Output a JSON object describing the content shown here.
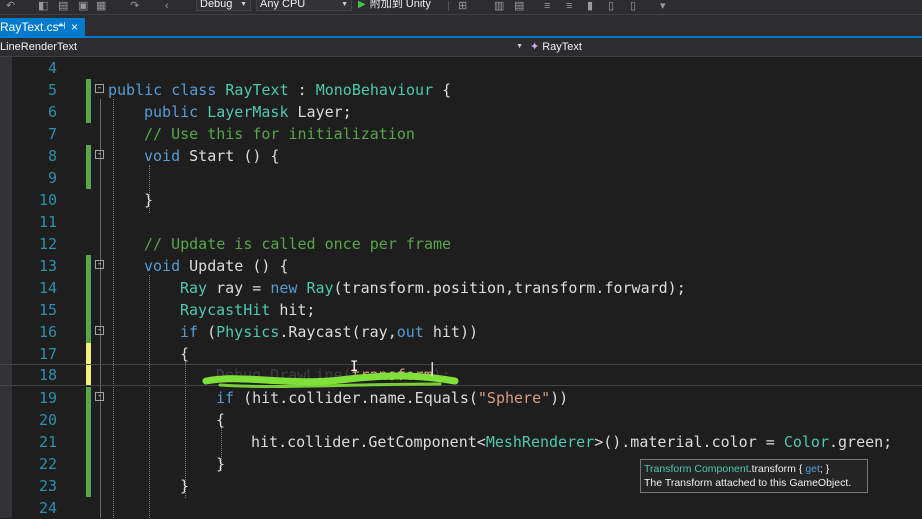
{
  "toolbar": {
    "configuration": "Debug",
    "platform": "Any CPU",
    "start_label": "附加到 Unity"
  },
  "tab": {
    "title": "RayText.cs*",
    "pin": "⊣",
    "close": "×"
  },
  "nav": {
    "left": "LineRenderText",
    "right": "RayText"
  },
  "editor": {
    "lines": [
      {
        "n": "4"
      },
      {
        "n": "5"
      },
      {
        "n": "6"
      },
      {
        "n": "7"
      },
      {
        "n": "8"
      },
      {
        "n": "9"
      },
      {
        "n": "10"
      },
      {
        "n": "11"
      },
      {
        "n": "12"
      },
      {
        "n": "13"
      },
      {
        "n": "14"
      },
      {
        "n": "15"
      },
      {
        "n": "16"
      },
      {
        "n": "17"
      },
      {
        "n": "18"
      },
      {
        "n": "19"
      },
      {
        "n": "20"
      },
      {
        "n": "21"
      },
      {
        "n": "22"
      },
      {
        "n": "23"
      },
      {
        "n": "24"
      }
    ],
    "code": {
      "l5_kw1": "public",
      "l5_kw2": "class",
      "l5_name": "RayText",
      "l5_colon": " : ",
      "l5_base": "MonoBehaviour",
      "l5_brace": " {",
      "l6_kw": "public",
      "l6_type": "LayerMask",
      "l6_rest": " Layer;",
      "l7_comment": "// Use this for initialization",
      "l8_kw": "void",
      "l8_rest": " Start () {",
      "l10": "}",
      "l12_comment": "// Update is called once per frame",
      "l13_kw": "void",
      "l13_rest": " Update () {",
      "l14_type1": "Ray",
      "l14_a": " ray = ",
      "l14_kw": "new",
      "l14_type2": "Ray",
      "l14_b": "(transform.position,transform.forward);",
      "l15_type": "RaycastHit",
      "l15_rest": " hit;",
      "l16_kw": "if",
      "l16_a": " (",
      "l16_type": "Physics",
      "l16_b": ".Raycast(ray,",
      "l16_kw2": "out",
      "l16_c": " hit))",
      "l17": "{",
      "l18_a": "Debug",
      "l18_b": ".DrawLine(",
      "l18_c": "transform",
      "l18_d": ");",
      "l19_kw": "if",
      "l19_a": " (hit.collider.name.Equals(",
      "l19_str": "\"Sphere\"",
      "l19_b": "))",
      "l20": "{",
      "l21_a": "hit.collider.GetComponent<",
      "l21_type": "MeshRenderer",
      "l21_b": ">().material.color = ",
      "l21_type2": "Color",
      "l21_c": ".green;",
      "l22": "}",
      "l23": "}"
    }
  },
  "tooltip": {
    "type": "Transform Component",
    "member": ".transform { ",
    "kw": "get",
    "end": "; }",
    "desc": "The Transform attached to this GameObject."
  },
  "colors": {
    "keyword": "#569cd6",
    "type": "#4ec9b0",
    "comment": "#57a64a",
    "string": "#d69d85",
    "line_number": "#2b91af",
    "accent": "#007acc"
  }
}
